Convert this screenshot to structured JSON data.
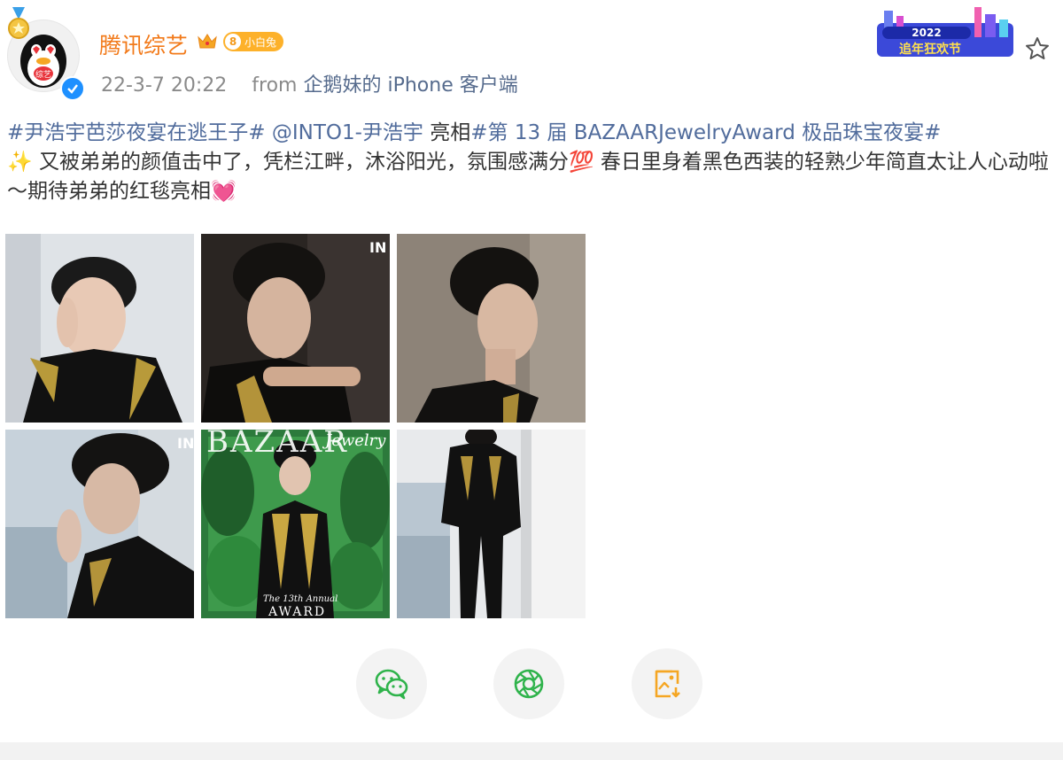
{
  "post": {
    "author": "腾讯综艺",
    "level": "8",
    "level_label": "小白兔",
    "avatar_text": "综艺",
    "timestamp": "22-3-7 20:22",
    "from_label": "from",
    "source": "企鹅妹的 iPhone 客户端"
  },
  "banner": {
    "year": "2022",
    "text": "追年狂欢节"
  },
  "content": {
    "topic1": "#尹浩宇芭莎夜宴在逃王子#",
    "mention": "@INTO1-尹浩宇",
    "text1": " 亮相",
    "topic2": "#第 13 届 BAZAARJewelryAward 极品珠宝夜宴#",
    "sparkle": "✨",
    "text2": " 又被弟弟的颜值击中了，凭栏江畔，沐浴阳光，氛围感满分",
    "hundred": "💯",
    "text3": " 春日里身着黑色西装的轻熟少年简直太让人心动啦～期待弟弟的红毯亮相",
    "heart": "💓"
  },
  "photos": [
    {
      "name": "photo-1"
    },
    {
      "name": "photo-2",
      "mark": "IN"
    },
    {
      "name": "photo-3"
    },
    {
      "name": "photo-4",
      "mark": "IN"
    },
    {
      "name": "photo-5",
      "cover_title": "BAZAAR",
      "cover_sub": "Jewelry",
      "cover_caption": "The 13th Annual",
      "cover_award": "AWARD"
    },
    {
      "name": "photo-6"
    }
  ],
  "actions": [
    {
      "icon": "wechat-icon"
    },
    {
      "icon": "moments-icon"
    },
    {
      "icon": "save-image-icon"
    }
  ],
  "colors": {
    "author": "#f27a1a",
    "link": "#516c9c",
    "meta": "#8a8a8a",
    "verified": "#1e90ff",
    "action_bg": "#f3f3f3"
  }
}
